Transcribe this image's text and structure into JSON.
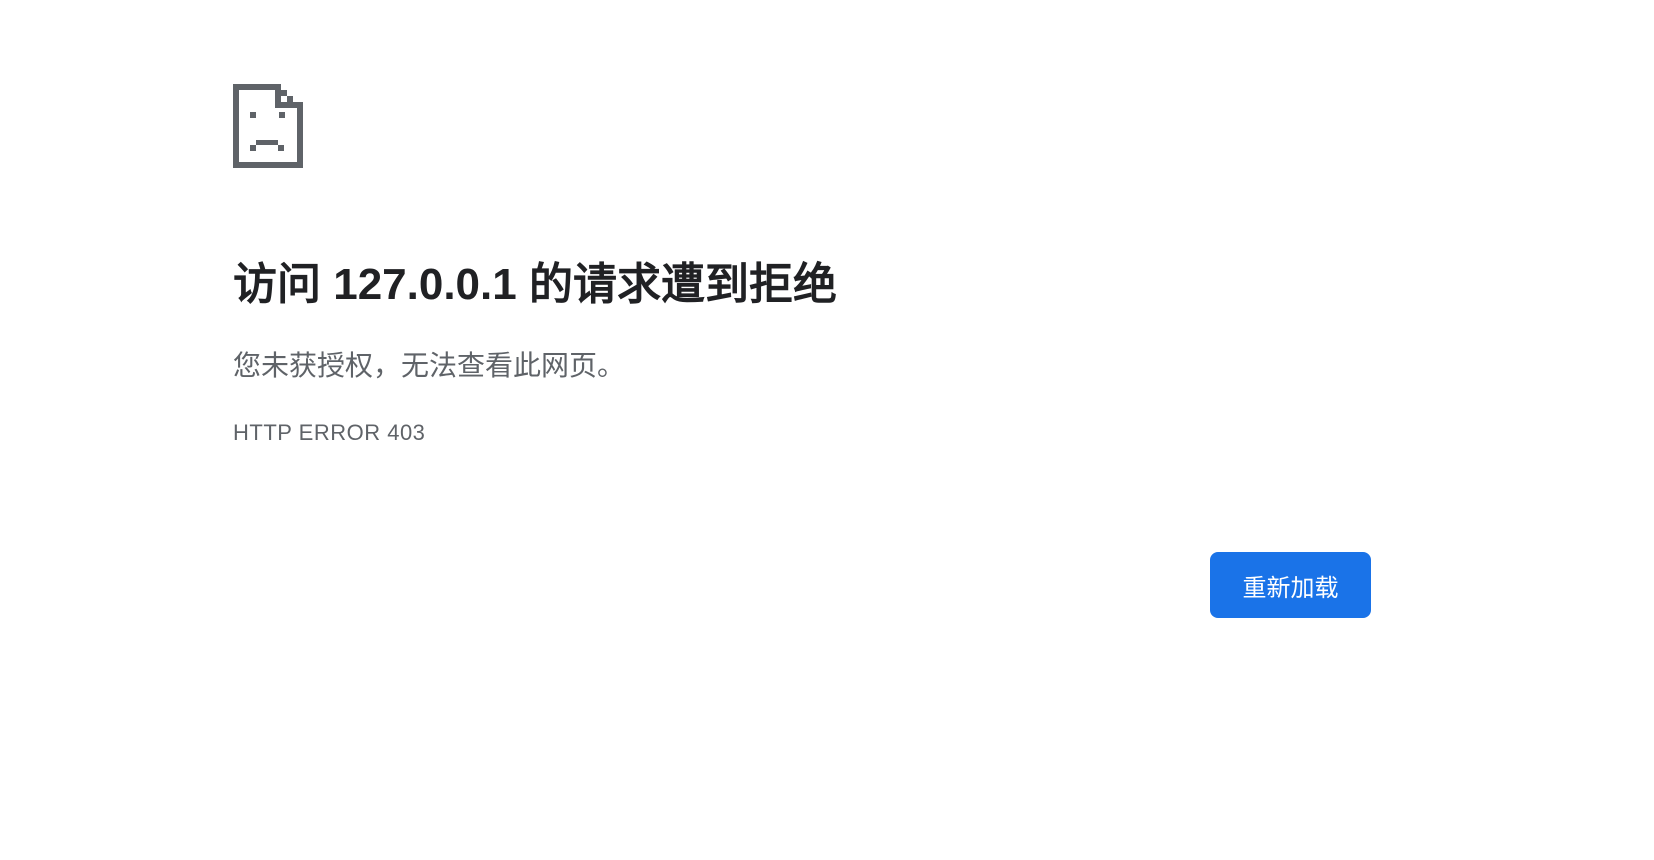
{
  "error": {
    "icon": "sad-page-icon",
    "heading": "访问 127.0.0.1 的请求遭到拒绝",
    "message": "您未获授权，无法查看此网页。",
    "code": "HTTP ERROR 403"
  },
  "actions": {
    "reload_label": "重新加载"
  },
  "colors": {
    "heading": "#202124",
    "secondary_text": "#5f6368",
    "icon": "#5f6368",
    "button_background": "#1a73e8",
    "button_text": "#ffffff",
    "page_background": "#ffffff"
  }
}
